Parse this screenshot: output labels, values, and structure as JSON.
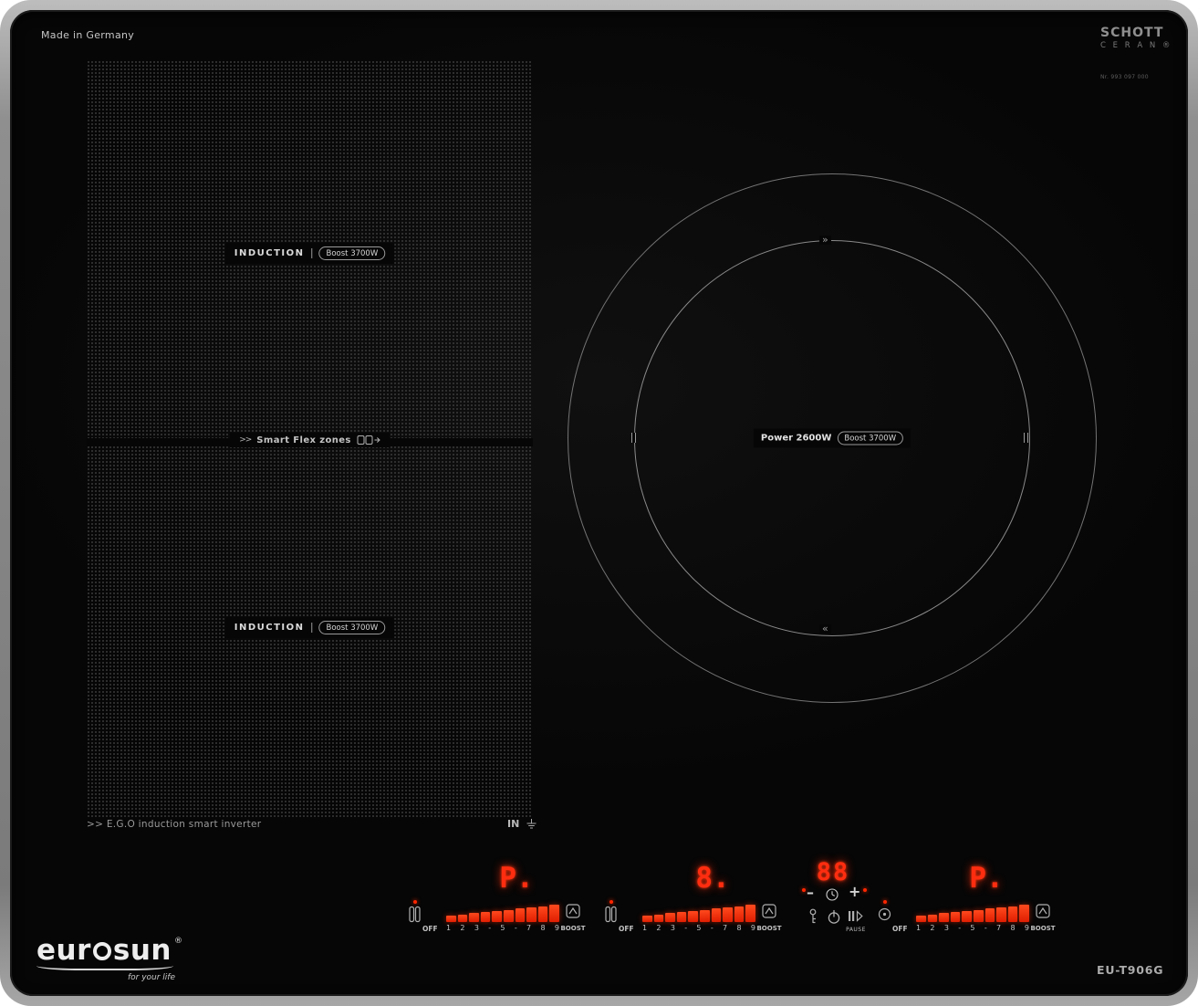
{
  "header": {
    "made_in": "Made in Germany",
    "schott": {
      "line1": "SCHOTT",
      "line2": "C E R A N ®",
      "serial": "Nr. 993 097 000"
    }
  },
  "zones": {
    "flex_top": {
      "name": "INDUCTION",
      "boost": "Boost 3700W"
    },
    "flex_bottom": {
      "name": "INDUCTION",
      "boost": "Boost 3700W"
    },
    "divider": {
      "chevrons": ">>",
      "label": "Smart Flex zones"
    },
    "round": {
      "power": "Power 2600W",
      "boost": "Boost 3700W"
    }
  },
  "notes": {
    "inverter": ">> E.G.O induction smart inverter",
    "in_label": "IN"
  },
  "controls": {
    "segments": 10,
    "scale_numbers": [
      "1",
      "2",
      "3",
      "-",
      "5",
      "-",
      "7",
      "8",
      "9"
    ],
    "off_label": "OFF",
    "boost_label": "BOOST",
    "pause_label": "PAUSE",
    "displays": {
      "zone_left": "P.",
      "zone_middle": "8.",
      "timer": "88",
      "zone_right": "P."
    },
    "timer_minus": "–",
    "timer_plus": "+"
  },
  "branding": {
    "logo_pre": "eur",
    "logo_post": "sun",
    "reg": "®",
    "tagline": "for your life",
    "model": "EU-T906G"
  },
  "colors": {
    "led": "#ff2d10",
    "frame": "#9a9a9a",
    "glass": "#060606"
  }
}
